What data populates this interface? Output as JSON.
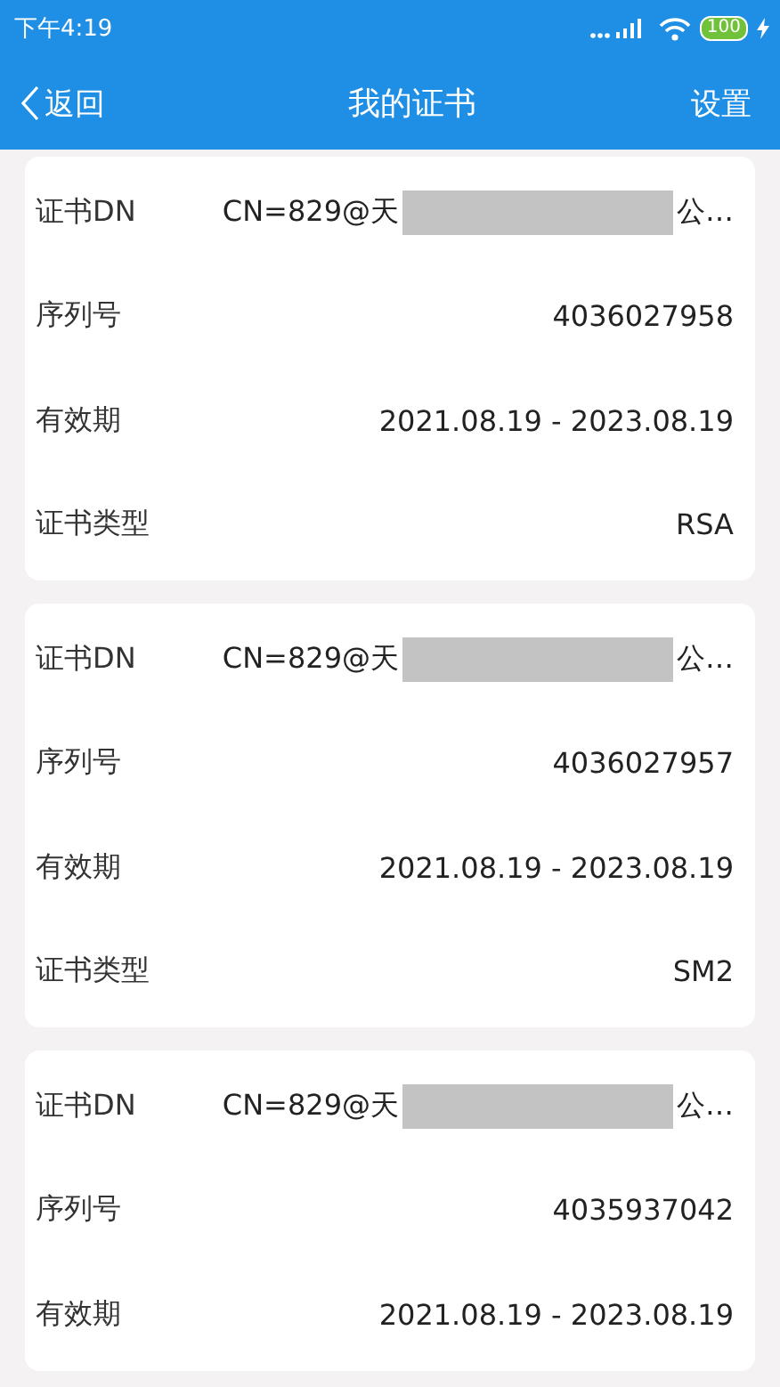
{
  "status_bar": {
    "time": "下午4:19",
    "battery": "100",
    "charging": true
  },
  "nav": {
    "back": "返回",
    "title": "我的证书",
    "action": "设置"
  },
  "certificates": [
    {
      "rows": [
        {
          "kind": "dn",
          "label": "证书DN",
          "value_start": "CN=829@天",
          "redacted": true,
          "value_end": "公…"
        },
        {
          "kind": "text",
          "label": "序列号",
          "value": "4036027958"
        },
        {
          "kind": "text",
          "label": "有效期",
          "value": "2021.08.19 - 2023.08.19"
        },
        {
          "kind": "text",
          "label": "证书类型",
          "value": "RSA"
        }
      ]
    },
    {
      "rows": [
        {
          "kind": "dn",
          "label": "证书DN",
          "value_start": "CN=829@天",
          "redacted": true,
          "value_end": "公…"
        },
        {
          "kind": "text",
          "label": "序列号",
          "value": "4036027957"
        },
        {
          "kind": "text",
          "label": "有效期",
          "value": "2021.08.19 - 2023.08.19"
        },
        {
          "kind": "text",
          "label": "证书类型",
          "value": "SM2"
        }
      ]
    },
    {
      "rows": [
        {
          "kind": "dn",
          "label": "证书DN",
          "value_start": "CN=829@天",
          "redacted": true,
          "value_end": "公…"
        },
        {
          "kind": "text",
          "label": "序列号",
          "value": "4035937042"
        },
        {
          "kind": "text",
          "label": "有效期",
          "value": "2021.08.19 - 2023.08.19"
        }
      ]
    }
  ]
}
